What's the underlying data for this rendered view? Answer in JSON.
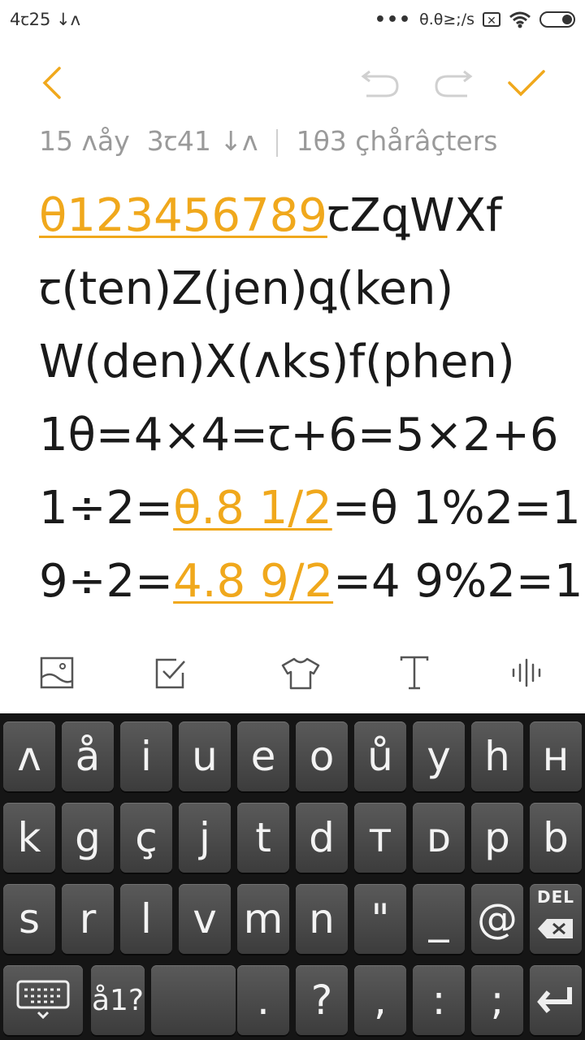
{
  "status_bar": {
    "time": "4ꞇ25 ↓ʌ",
    "speed": "θ.θ≥;/s",
    "icons": [
      "more-dots-icon",
      "sim-x-icon",
      "wifi-icon",
      "battery-icon"
    ]
  },
  "toolbar": {
    "icons": [
      "back-chevron-icon",
      "undo-icon",
      "redo-icon",
      "checkmark-icon"
    ],
    "accent_color": "#f0a81c"
  },
  "meta": {
    "date": "15 ʌåy",
    "time": "3ꞇ41 ↓ʌ",
    "characters": "1θ3 çhårâçters"
  },
  "note": {
    "line1_link": "θ123456789",
    "line1_rest": "ꞇZꝗWXf",
    "line2": "ꞇ(ten)Z(jen)ꝗ(ken)",
    "line3": "W(den)X(ʌks)f(phen)",
    "line4": "1θ=4×4=ꞇ+6=5×2+6",
    "line5_a": "1÷2=",
    "line5_link": "θ.8 1/2",
    "line5_b": "=θ 1%2=1",
    "line6_a": "9÷2=",
    "line6_link": "4.8 9/2",
    "line6_b": "=4 9%2=1"
  },
  "bottom_tools": [
    "image-icon",
    "checkbox-icon",
    "shirt-icon",
    "text-format-icon",
    "voice-icon"
  ],
  "keyboard": {
    "row1": [
      "ʌ",
      "å",
      "i",
      "u",
      "e",
      "o",
      "ů",
      "y",
      "h",
      "н"
    ],
    "row2": [
      "k",
      "g",
      "ç",
      "j",
      "t",
      "d",
      "т",
      "ᴅ",
      "p",
      "b"
    ],
    "row3": [
      "s",
      "r",
      "l",
      "v",
      "m",
      "n",
      "\"",
      "_",
      "@"
    ],
    "del_label": "DEL",
    "row4_symbols": "å1?",
    "row4": [
      ".",
      "?",
      ",",
      ":",
      ";"
    ]
  }
}
